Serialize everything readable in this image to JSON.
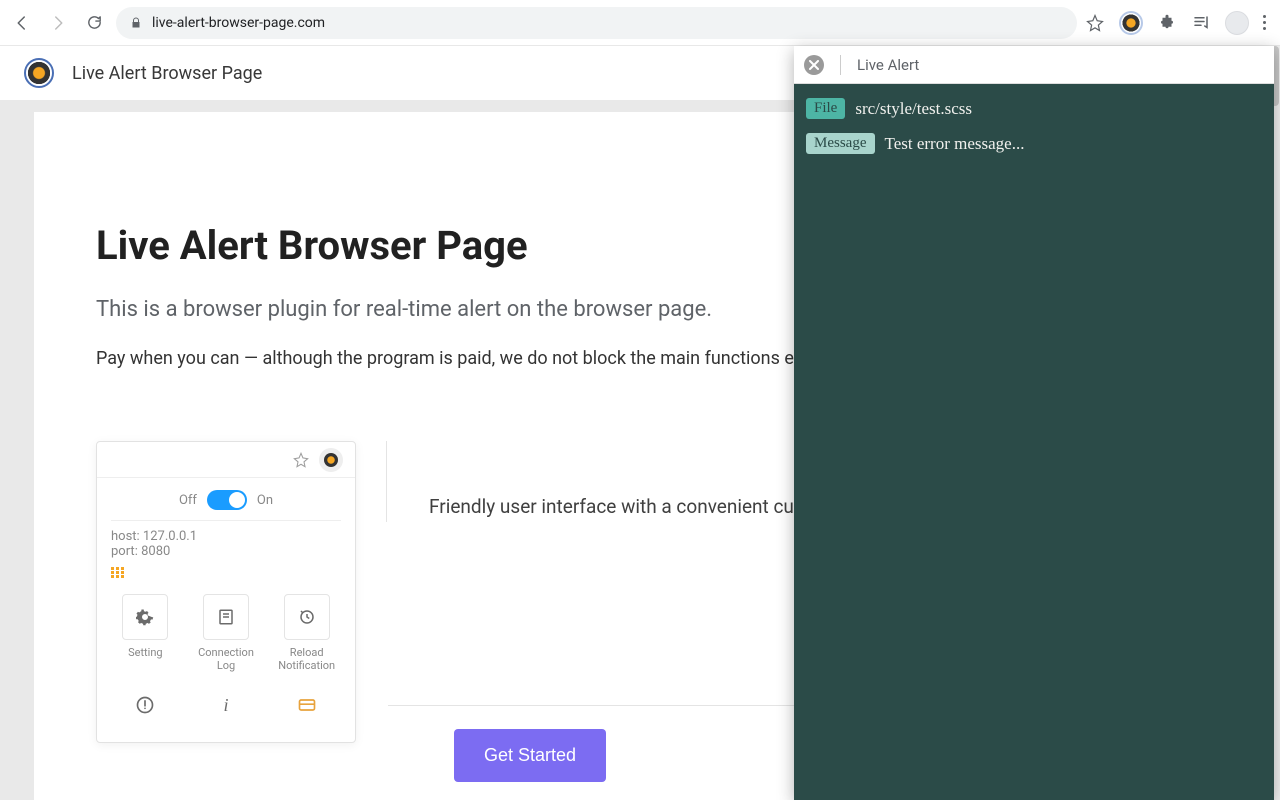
{
  "browser": {
    "url": "live-alert-browser-page.com"
  },
  "site": {
    "title": "Live Alert Browser Page"
  },
  "page": {
    "heading": "Live Alert Browser Page",
    "subtitle": "This is a browser plugin for real-time alert on the browser page.",
    "paragraph": "Pay when you can — although the program is paid, we do not block the main functions even without a license.",
    "feature_text": "Friendly user interface with a convenient customization system of this plugin.",
    "cta": "Get Started"
  },
  "demo": {
    "off_label": "Off",
    "on_label": "On",
    "host_label": "host:",
    "host_value": "127.0.0.1",
    "port_label": "port:",
    "port_value": "8080",
    "tiles": [
      {
        "label": "Setting",
        "icon": "gear"
      },
      {
        "label": "Connection Log",
        "icon": "log"
      },
      {
        "label": "Reload Notification",
        "icon": "reload"
      }
    ],
    "tiles2_icons": [
      "alert-circle",
      "info-i",
      "card"
    ]
  },
  "alert": {
    "panel_title": "Live Alert",
    "file_badge": "File",
    "file_value": "src/style/test.scss",
    "message_badge": "Message",
    "message_value": "Test error message..."
  }
}
